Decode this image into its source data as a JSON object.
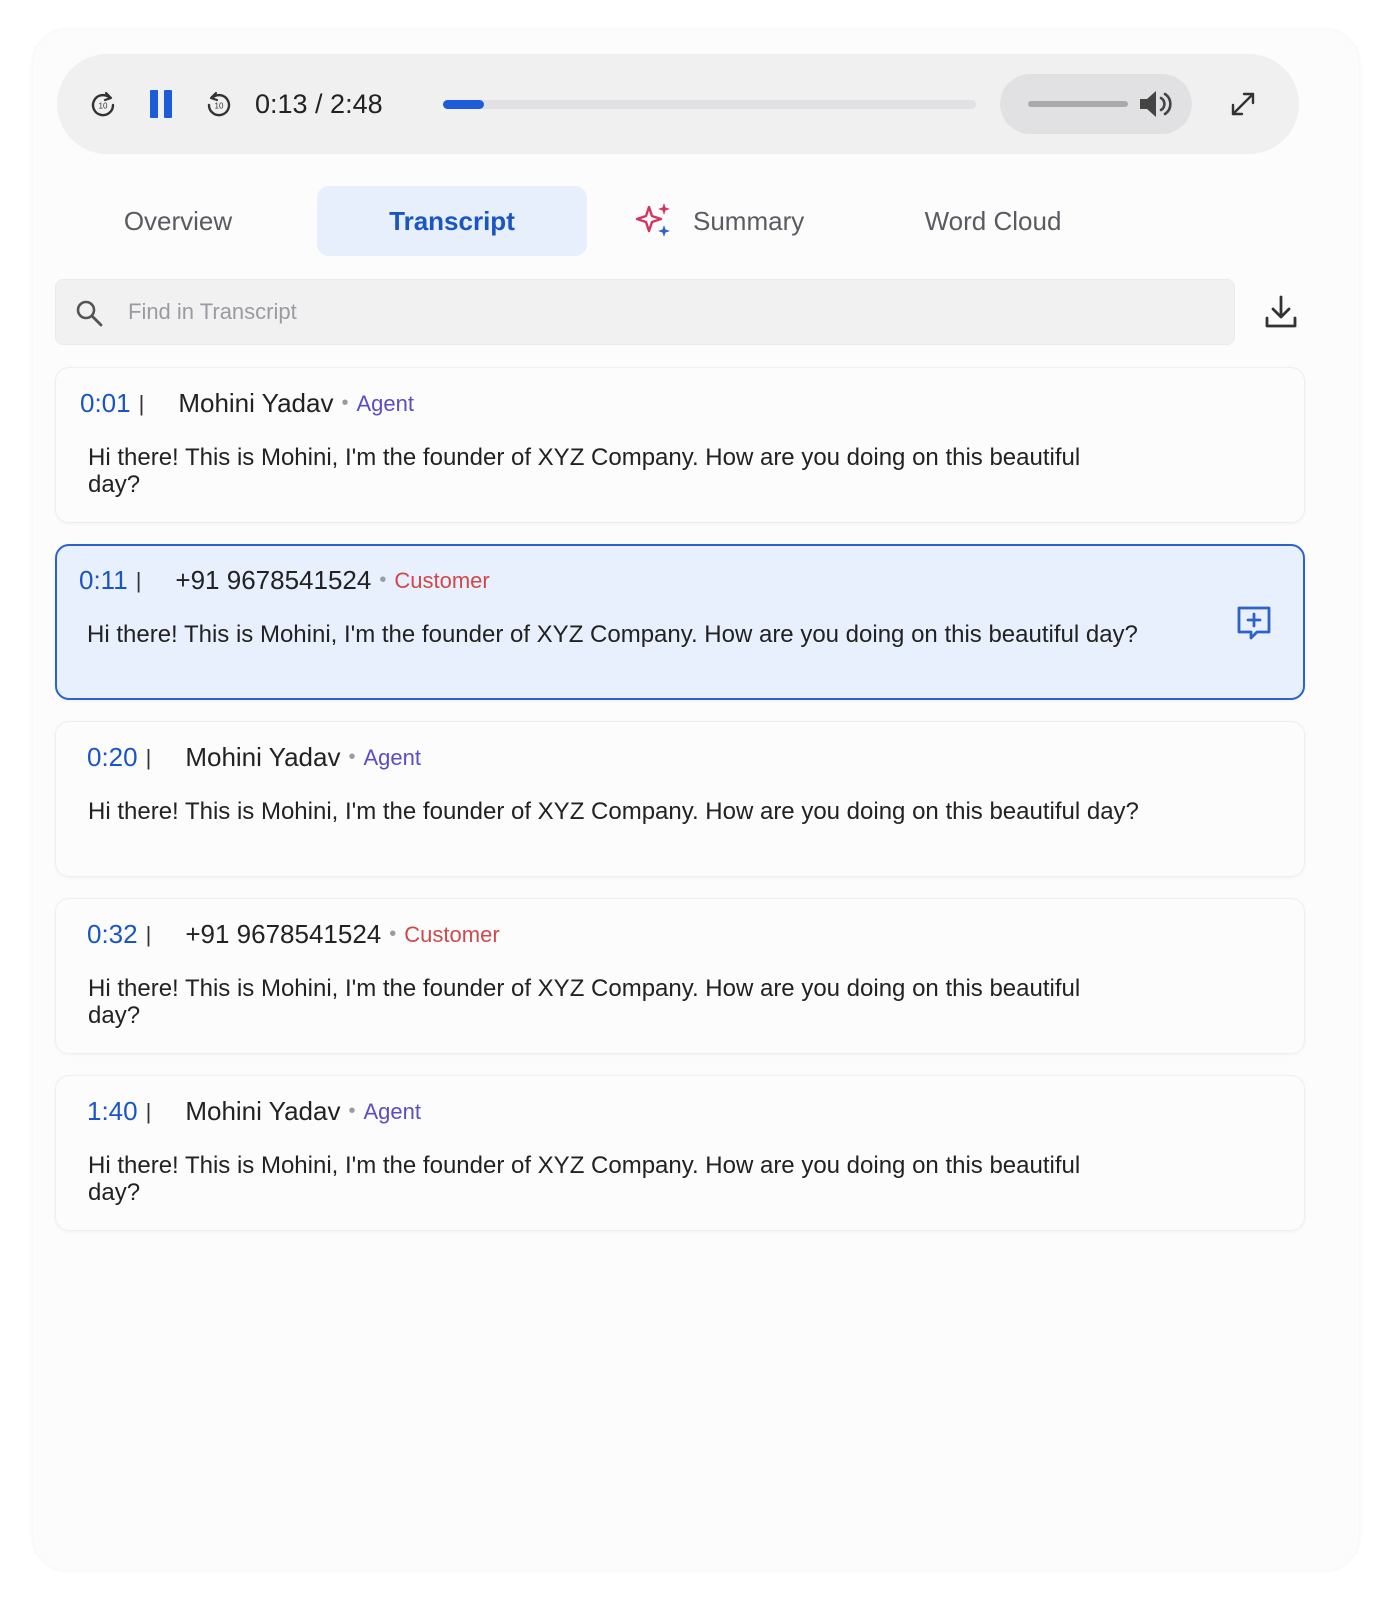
{
  "player": {
    "current_time": "0:13",
    "duration": "2:48",
    "time_display": "0:13 / 2:48",
    "progress_fraction": 0.077,
    "volume_fraction": 1.0,
    "icons": {
      "rewind": "rewind-10-icon",
      "pause": "pause-icon",
      "forward": "forward-10-icon",
      "volume": "volume-icon",
      "expand": "expand-icon"
    }
  },
  "tabs": [
    {
      "label": "Overview",
      "active": false
    },
    {
      "label": "Transcript",
      "active": true
    },
    {
      "label": "Summary",
      "active": false,
      "icon": "sparkle-icon"
    },
    {
      "label": "Word Cloud",
      "active": false
    }
  ],
  "search": {
    "placeholder": "Find in Transcript",
    "value": ""
  },
  "entries": [
    {
      "time": "0:01",
      "speaker": "Mohini Yadav",
      "role": "Agent",
      "text": "Hi there! This is Mohini, I'm the founder of XYZ Company. How are you doing on this beautiful day?"
    },
    {
      "time": "0:11",
      "speaker": "+91 9678541524",
      "role": "Customer",
      "text": "Hi there! This is Mohini, I'm the founder of XYZ Company. How are you doing on this beautiful day?"
    },
    {
      "time": "0:20",
      "speaker": "Mohini Yadav",
      "role": "Agent",
      "text": "Hi there! This is Mohini, I'm the founder of XYZ Company. How are you doing on this beautiful day?"
    },
    {
      "time": "0:32",
      "speaker": "+91 9678541524",
      "role": "Customer",
      "text": "Hi there! This is Mohini, I'm the founder of XYZ Company. How are you doing on this beautiful day?"
    },
    {
      "time": "1:40",
      "speaker": "Mohini Yadav",
      "role": "Agent",
      "text": "Hi there! This is Mohini, I'm the founder of XYZ Company. How are you doing on this beautiful day?"
    }
  ],
  "colors": {
    "accent": "#1a55c4",
    "agent": "#5a4ec4",
    "customer": "#cf4949",
    "active_bg": "#e8effd"
  }
}
